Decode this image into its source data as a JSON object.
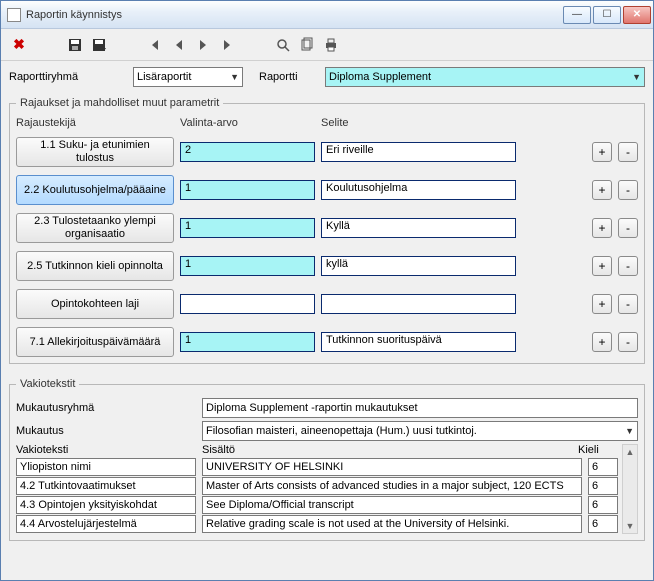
{
  "window": {
    "title": "Raportin käynnistys"
  },
  "toolbar": {
    "close": "✖",
    "save": "save-icon",
    "saveas": "saveas-icon",
    "first": "first-icon",
    "prev": "prev-icon",
    "next": "next-icon",
    "last": "last-icon",
    "search": "search-icon",
    "copy": "copy-icon",
    "print": "print-icon"
  },
  "filters": {
    "group_label": "Raporttiryhmä",
    "group_value": "Lisäraportit",
    "report_label": "Raportti",
    "report_value": "Diploma Supplement"
  },
  "params": {
    "legend": "Rajaukset ja mahdolliset muut parametrit",
    "col_rajaustekija": "Rajaustekijä",
    "col_valinta": "Valinta-arvo",
    "col_selite": "Selite",
    "rows": [
      {
        "label": "1.1 Suku- ja etunimien tulostus",
        "value": "2",
        "selite": "Eri riveille",
        "selected": false,
        "blank": false
      },
      {
        "label": "2.2 Koulutusohjelma/pääaine",
        "value": "1",
        "selite": "Koulutusohjelma",
        "selected": true,
        "blank": false
      },
      {
        "label": "2.3 Tulostetaanko ylempi organisaatio",
        "value": "1",
        "selite": "Kyllä",
        "selected": false,
        "blank": false
      },
      {
        "label": "2.5 Tutkinnon kieli opinnolta",
        "value": "1",
        "selite": "kyllä",
        "selected": false,
        "blank": false
      },
      {
        "label": "Opintokohteen laji",
        "value": "",
        "selite": "",
        "selected": false,
        "blank": true
      },
      {
        "label": "7.1 Allekirjoituspäivämäärä",
        "value": "1",
        "selite": "Tutkinnon suorituspäivä",
        "selected": false,
        "blank": false
      }
    ]
  },
  "vakiot": {
    "legend": "Vakiotekstit",
    "mukautusryhma_label": "Mukautusryhmä",
    "mukautusryhma_value": "Diploma Supplement -raportin mukautukset",
    "mukautus_label": "Mukautus",
    "mukautus_value": "Filosofian maisteri, aineenopettaja (Hum.) uusi tutkintoj.",
    "col_vakioteksti": "Vakioteksti",
    "col_sisalto": "Sisältö",
    "col_kieli": "Kieli",
    "rows": [
      {
        "name": "Yliopiston nimi",
        "content": "UNIVERSITY OF HELSINKI",
        "lang": "6"
      },
      {
        "name": "4.2 Tutkintovaatimukset",
        "content": "Master of Arts consists of advanced studies in a major subject, 120 ECTS",
        "lang": "6"
      },
      {
        "name": "4.3 Opintojen yksityiskohdat",
        "content": "See Diploma/Official transcript",
        "lang": "6"
      },
      {
        "name": "4.4 Arvostelujärjestelmä",
        "content": "Relative grading scale is not used at the University of Helsinki.",
        "lang": "6"
      }
    ]
  }
}
